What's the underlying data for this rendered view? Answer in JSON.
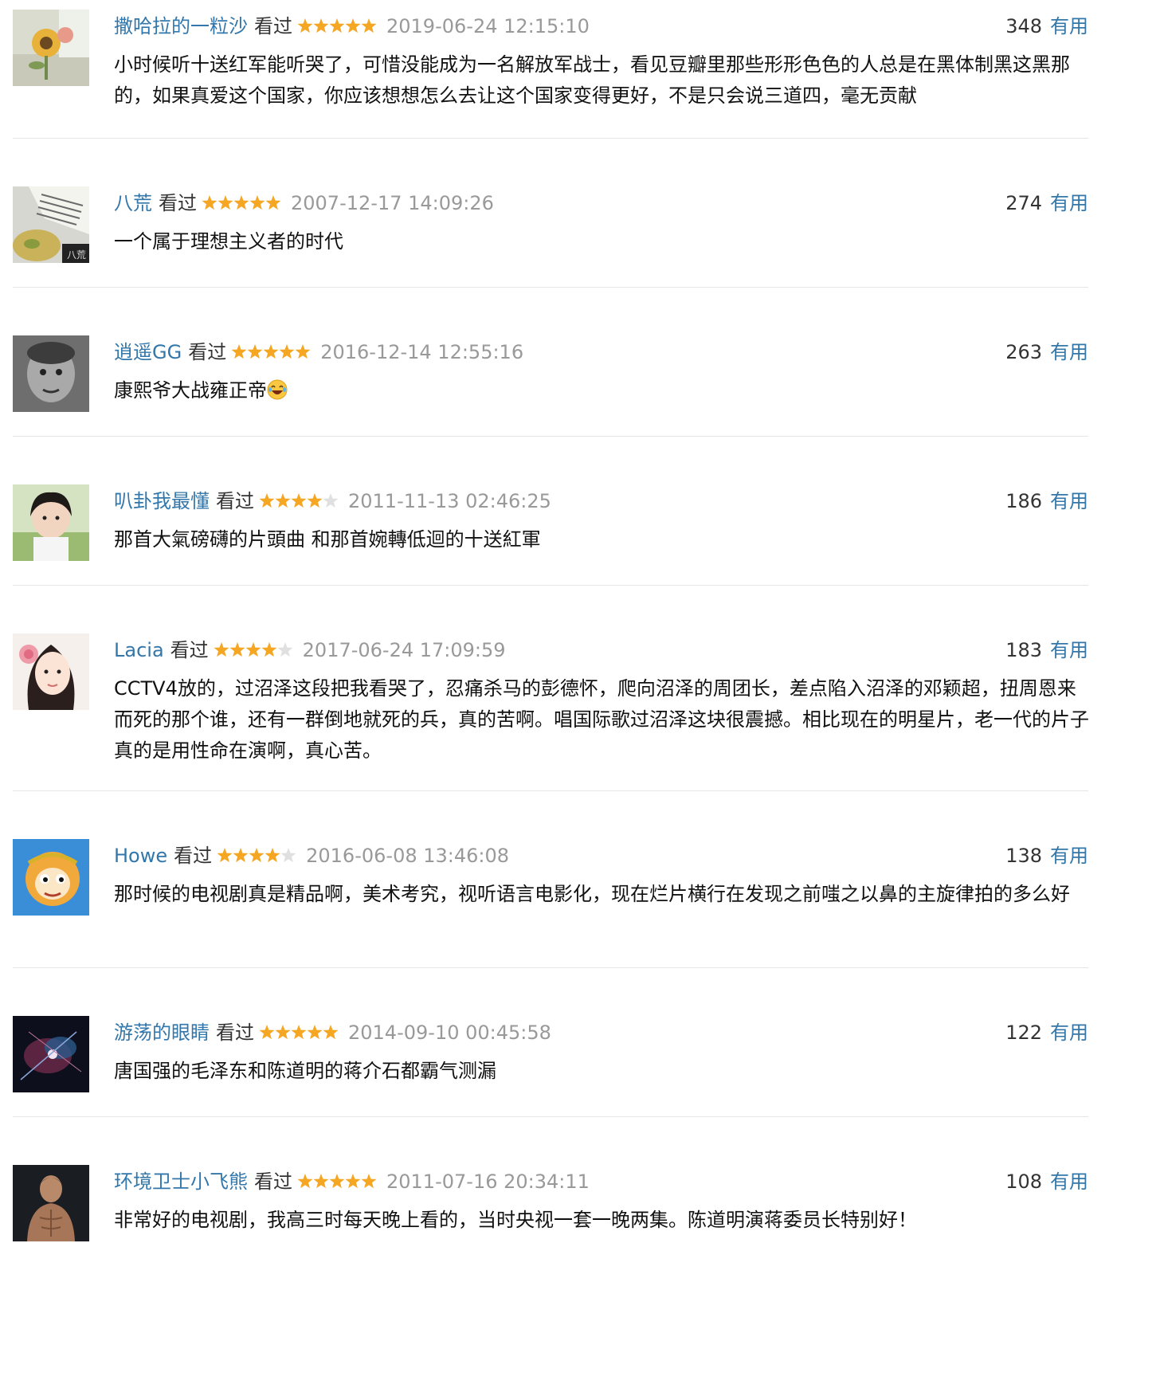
{
  "comments": [
    {
      "user": "撒哈拉的一粒沙",
      "status": "看过",
      "rating": 5,
      "time": "2019-06-24 12:15:10",
      "votes": "348",
      "useful_label": "有用",
      "text": "小时候听十送红军能听哭了，可惜没能成为一名解放军战士，看见豆瓣里那些形形色色的人总是在黑体制黑这黑那的，如果真爱这个国家，你应该想想怎么去让这个国家变得更好，不是只会说三道四，毫无贡献"
    },
    {
      "user": "八荒",
      "status": "看过",
      "rating": 5,
      "time": "2007-12-17 14:09:26",
      "votes": "274",
      "useful_label": "有用",
      "text": "一个属于理想主义者的时代",
      "avatar_caption": "八荒"
    },
    {
      "user": "逍遥GG",
      "status": "看过",
      "rating": 5,
      "time": "2016-12-14 12:55:16",
      "votes": "263",
      "useful_label": "有用",
      "text": "康熙爷大战雍正帝"
    },
    {
      "user": "叭卦我最懂",
      "status": "看过",
      "rating": 4,
      "time": "2011-11-13 02:46:25",
      "votes": "186",
      "useful_label": "有用",
      "text": "那首大氣磅礴的片頭曲 和那首婉轉低迴的十送紅軍"
    },
    {
      "user": "Lacia",
      "status": "看过",
      "rating": 4,
      "time": "2017-06-24 17:09:59",
      "votes": "183",
      "useful_label": "有用",
      "text": "CCTV4放的，过沼泽这段把我看哭了，忍痛杀马的彭德怀，爬向沼泽的周团长，差点陷入沼泽的邓颖超，扭周恩来而死的那个谁，还有一群倒地就死的兵，真的苦啊。唱国际歌过沼泽这块很震撼。相比现在的明星片，老一代的片子真的是用性命在演啊，真心苦。"
    },
    {
      "user": "Howe",
      "status": "看过",
      "rating": 4,
      "time": "2016-06-08 13:46:08",
      "votes": "138",
      "useful_label": "有用",
      "text": "那时候的电视剧真是精品啊，美术考究，视听语言电影化，现在烂片横行在发现之前嗤之以鼻的主旋律拍的多么好"
    },
    {
      "user": "游荡的眼睛",
      "status": "看过",
      "rating": 5,
      "time": "2014-09-10 00:45:58",
      "votes": "122",
      "useful_label": "有用",
      "text": "唐国强的毛泽东和陈道明的蒋介石都霸气测漏"
    },
    {
      "user": "环境卫士小飞熊",
      "status": "看过",
      "rating": 5,
      "time": "2011-07-16 20:34:11",
      "votes": "108",
      "useful_label": "有用",
      "text": "非常好的电视剧，我高三时每天晚上看的，当时央视一套一晚两集。陈道明演蒋委员长特别好！"
    }
  ],
  "colors": {
    "link": "#3377aa",
    "star": "#f5a623",
    "star_empty": "#e0e0e0",
    "time": "#999999"
  }
}
